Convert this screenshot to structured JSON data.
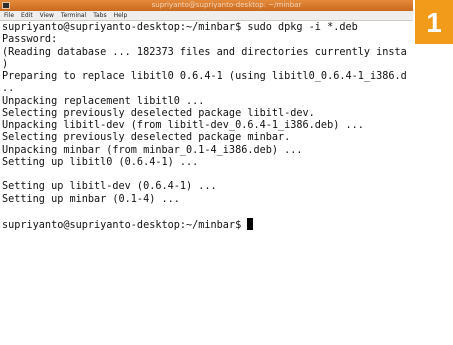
{
  "window": {
    "title": "supriyanto@supriyanto-desktop: ~/minbar"
  },
  "menu": {
    "items": [
      "File",
      "Edit",
      "View",
      "Terminal",
      "Tabs",
      "Help"
    ]
  },
  "terminal": {
    "lines": [
      "supriyanto@supriyanto-desktop:~/minbar$ sudo dpkg -i *.deb",
      "Password:",
      "(Reading database ... 182373 files and directories currently insta",
      ")",
      "Preparing to replace libitl0 0.6.4-1 (using libitl0_0.6.4-1_i386.d",
      "..",
      "Unpacking replacement libitl0 ...",
      "Selecting previously deselected package libitl-dev.",
      "Unpacking libitl-dev (from libitl-dev_0.6.4-1_i386.deb) ...",
      "Selecting previously deselected package minbar.",
      "Unpacking minbar (from minbar_0.1-4_i386.deb) ...",
      "Setting up libitl0 (0.6.4-1) ...",
      "",
      "Setting up libitl-dev (0.6.4-1) ...",
      "Setting up minbar (0.1-4) ...",
      "",
      "supriyanto@supriyanto-desktop:~/minbar$ "
    ]
  },
  "badge": {
    "number": "1",
    "color": "#f29b1b"
  },
  "icons": {
    "window_icon": "terminal-window-icon",
    "cursor": "block-cursor"
  }
}
